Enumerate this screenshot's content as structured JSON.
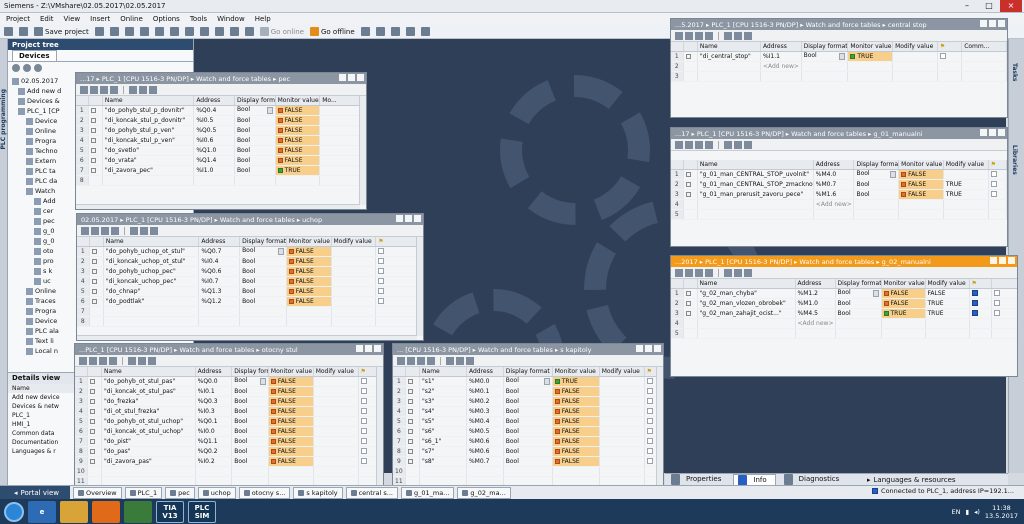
{
  "window": {
    "title": "Siemens - Z:\\VMshare\\02.05.2017\\02.05.2017"
  },
  "menu": [
    "Project",
    "Edit",
    "View",
    "Insert",
    "Online",
    "Options",
    "Tools",
    "Window",
    "Help"
  ],
  "toolbar": {
    "save_project": "Save project",
    "go_online": "Go online",
    "go_offline": "Go offline"
  },
  "left_vtab": "PLC programming",
  "project_tree": {
    "header": "Project tree",
    "tab": "Devices",
    "items": [
      "02.05.2017",
      "Add new d",
      "Devices &",
      "PLC_1 [CP",
      "Device",
      "Online",
      "Progra",
      "Techno",
      "Extern",
      "PLC ta",
      "PLC da",
      "Watch",
      "Add",
      "cer",
      "pec",
      "g_0",
      "g_0",
      "oto",
      "pro",
      "s k",
      "uc",
      "Online",
      "Traces",
      "Progra",
      "Device",
      "PLC ala",
      "Text li",
      "Local n"
    ]
  },
  "details_view": {
    "header": "Details view",
    "name_col": "Name",
    "items": [
      "Add new device",
      "Devices & netw",
      "PLC_1",
      "HMI_1",
      "Common data",
      "Documentation",
      "Languages & r"
    ]
  },
  "right_vtabs": [
    "Tasks",
    "Libraries"
  ],
  "columns": {
    "name": "Name",
    "address": "Address",
    "display_format": "Display format",
    "monitor_value": "Monitor value",
    "modify_value": "Modify value",
    "comment": "Comm...",
    "mo": "Mo..."
  },
  "add_new": "<Add new>",
  "wt_pec": {
    "title": "...17 ▸ PLC_1 [CPU 1516-3 PN/DP] ▸ Watch and force tables ▸ pec",
    "rows": [
      {
        "n": "1",
        "name": "\"do_pohyb_stul_p_dovnitr\"",
        "addr": "%Q0.4",
        "fmt": "Bool",
        "mon": "FALSE",
        "st": "off"
      },
      {
        "n": "2",
        "name": "\"di_koncak_stul_p_dovnitr\"",
        "addr": "%I0.5",
        "fmt": "Bool",
        "mon": "FALSE",
        "st": "off"
      },
      {
        "n": "3",
        "name": "\"do_pohyb_stul_p_ven\"",
        "addr": "%Q0.5",
        "fmt": "Bool",
        "mon": "FALSE",
        "st": "off"
      },
      {
        "n": "4",
        "name": "\"di_koncak_stul_p_ven\"",
        "addr": "%I0.6",
        "fmt": "Bool",
        "mon": "FALSE",
        "st": "off"
      },
      {
        "n": "5",
        "name": "\"do_svetlo\"",
        "addr": "%Q1.0",
        "fmt": "Bool",
        "mon": "FALSE",
        "st": "off"
      },
      {
        "n": "6",
        "name": "\"do_vrata\"",
        "addr": "%Q1.4",
        "fmt": "Bool",
        "mon": "FALSE",
        "st": "off"
      },
      {
        "n": "7",
        "name": "\"di_zavora_pec\"",
        "addr": "%I1.0",
        "fmt": "Bool",
        "mon": "TRUE",
        "st": "on"
      }
    ]
  },
  "wt_uchop": {
    "title": "02.05.2017 ▸ PLC_1 [CPU 1516-3 PN/DP] ▸ Watch and force tables ▸ uchop",
    "rows": [
      {
        "n": "1",
        "name": "\"do_pohyb_uchop_ot_stul\"",
        "addr": "%Q0.7",
        "fmt": "Bool",
        "mon": "FALSE",
        "st": "off"
      },
      {
        "n": "2",
        "name": "\"di_koncak_uchop_ot_stul\"",
        "addr": "%I0.4",
        "fmt": "Bool",
        "mon": "FALSE",
        "st": "off"
      },
      {
        "n": "3",
        "name": "\"do_pohyb_uchop_pec\"",
        "addr": "%Q0.6",
        "fmt": "Bool",
        "mon": "FALSE",
        "st": "off"
      },
      {
        "n": "4",
        "name": "\"di_koncak_uchop_pec\"",
        "addr": "%I0.7",
        "fmt": "Bool",
        "mon": "FALSE",
        "st": "off"
      },
      {
        "n": "5",
        "name": "\"do_chnap\"",
        "addr": "%Q1.3",
        "fmt": "Bool",
        "mon": "FALSE",
        "st": "off"
      },
      {
        "n": "6",
        "name": "\"do_podtlak\"",
        "addr": "%Q1.2",
        "fmt": "Bool",
        "mon": "FALSE",
        "st": "off"
      }
    ]
  },
  "wt_otocny": {
    "title": "...PLC_1 [CPU 1516-3 PN/DP] ▸ Watch and force tables ▸ otocny stul",
    "rows": [
      {
        "n": "1",
        "name": "\"do_pohyb_ot_stul_pas\"",
        "addr": "%Q0.0",
        "fmt": "Bool",
        "mon": "FALSE",
        "st": "off"
      },
      {
        "n": "2",
        "name": "\"di_koncak_ot_stul_pas\"",
        "addr": "%I0.1",
        "fmt": "Bool",
        "mon": "FALSE",
        "st": "off"
      },
      {
        "n": "3",
        "name": "\"do_frezka\"",
        "addr": "%Q0.3",
        "fmt": "Bool",
        "mon": "FALSE",
        "st": "off"
      },
      {
        "n": "4",
        "name": "\"di_ot_stul_frezka\"",
        "addr": "%I0.3",
        "fmt": "Bool",
        "mon": "FALSE",
        "st": "off"
      },
      {
        "n": "5",
        "name": "\"do_pohyb_ot_stul_uchop\"",
        "addr": "%Q0.1",
        "fmt": "Bool",
        "mon": "FALSE",
        "st": "off"
      },
      {
        "n": "6",
        "name": "\"di_koncak_ot_stul_uchop\"",
        "addr": "%I0.0",
        "fmt": "Bool",
        "mon": "FALSE",
        "st": "off"
      },
      {
        "n": "7",
        "name": "\"do_pist\"",
        "addr": "%Q1.1",
        "fmt": "Bool",
        "mon": "FALSE",
        "st": "off"
      },
      {
        "n": "8",
        "name": "\"do_pas\"",
        "addr": "%Q0.2",
        "fmt": "Bool",
        "mon": "FALSE",
        "st": "off"
      },
      {
        "n": "9",
        "name": "\"di_zavora_pas\"",
        "addr": "%I0.2",
        "fmt": "Bool",
        "mon": "FALSE",
        "st": "off"
      }
    ]
  },
  "wt_kapitoly": {
    "title": "... [CPU 1516-3 PN/DP] ▸ Watch and force tables ▸ s kapitoly",
    "rows": [
      {
        "n": "1",
        "name": "\"s1\"",
        "addr": "%M0.0",
        "fmt": "Bool",
        "mon": "TRUE",
        "st": "on"
      },
      {
        "n": "2",
        "name": "\"s2\"",
        "addr": "%M0.1",
        "fmt": "Bool",
        "mon": "FALSE",
        "st": "off"
      },
      {
        "n": "3",
        "name": "\"s3\"",
        "addr": "%M0.2",
        "fmt": "Bool",
        "mon": "FALSE",
        "st": "off"
      },
      {
        "n": "4",
        "name": "\"s4\"",
        "addr": "%M0.3",
        "fmt": "Bool",
        "mon": "FALSE",
        "st": "off"
      },
      {
        "n": "5",
        "name": "\"s5\"",
        "addr": "%M0.4",
        "fmt": "Bool",
        "mon": "FALSE",
        "st": "off"
      },
      {
        "n": "6",
        "name": "\"s6\"",
        "addr": "%M0.5",
        "fmt": "Bool",
        "mon": "FALSE",
        "st": "off"
      },
      {
        "n": "7",
        "name": "\"s6_1\"",
        "addr": "%M0.6",
        "fmt": "Bool",
        "mon": "FALSE",
        "st": "off"
      },
      {
        "n": "8",
        "name": "\"s7\"",
        "addr": "%M0.6",
        "fmt": "Bool",
        "mon": "FALSE",
        "st": "off"
      },
      {
        "n": "9",
        "name": "\"s8\"",
        "addr": "%M0.7",
        "fmt": "Bool",
        "mon": "FALSE",
        "st": "off"
      }
    ]
  },
  "wt_central": {
    "title": "...5.2017 ▸ PLC_1 [CPU 1516-3 PN/DP] ▸ Watch and force tables ▸ central stop",
    "rows": [
      {
        "n": "1",
        "name": "\"di_central_stop\"",
        "addr": "%I1.1",
        "fmt": "Bool",
        "mon": "TRUE",
        "st": "on",
        "mod": ""
      }
    ]
  },
  "wt_g01": {
    "title": "...17 ▸ PLC_1 [CPU 1516-3 PN/DP] ▸ Watch and force tables ▸ g_01_manualni",
    "rows": [
      {
        "n": "1",
        "name": "\"g_01_man_CENTRAL_STOP_uvolnit\"",
        "addr": "%M4.0",
        "fmt": "Bool",
        "mon": "FALSE",
        "st": "off",
        "mod": ""
      },
      {
        "n": "2",
        "name": "\"g_01_man_CENTRAL_STOP_zmacknout\"",
        "addr": "%M0.7",
        "fmt": "Bool",
        "mon": "FALSE",
        "st": "off",
        "mod": "TRUE"
      },
      {
        "n": "3",
        "name": "\"g_01_man_prerusit_zavoru_pece\"",
        "addr": "%M1.6",
        "fmt": "Bool",
        "mon": "FALSE",
        "st": "off",
        "mod": "TRUE"
      }
    ]
  },
  "wt_g02": {
    "title": "...2017 ▸ PLC_1 [CPU 1516-3 PN/DP] ▸ Watch and force tables ▸ g_02_manualni",
    "rows": [
      {
        "n": "1",
        "name": "\"g_02_man_chyba\"",
        "addr": "%M1.2",
        "fmt": "Bool",
        "mon": "FALSE",
        "st": "off",
        "mod": "FALSE",
        "chk": true
      },
      {
        "n": "2",
        "name": "\"g_02_man_vlozen_obrobek\"",
        "addr": "%M1.0",
        "fmt": "Bool",
        "mon": "FALSE",
        "st": "off",
        "mod": "TRUE",
        "chk": true
      },
      {
        "n": "3",
        "name": "\"g_02_man_zahajit_ocist...\"",
        "addr": "%M4.5",
        "fmt": "Bool",
        "mon": "TRUE",
        "st": "on",
        "mod": "TRUE",
        "chk": true
      }
    ]
  },
  "inspector": {
    "properties": "Properties",
    "info": "Info",
    "diagnostics": "Diagnostics"
  },
  "languages": "Languages & resources",
  "portal": {
    "portal_view": "Portal view",
    "tabs": [
      "Overview",
      "PLC_1",
      "pec",
      "uchop",
      "otocny s...",
      "s kapitoly",
      "central s...",
      "g_01_ma...",
      "g_02_ma..."
    ],
    "status": "Connected to PLC_1, address IP=192.1..."
  },
  "taskbar": {
    "apps": [
      "TIA V13",
      "PLC SIM"
    ],
    "lang": "EN",
    "time": "11:38",
    "date": "13.5.2017"
  },
  "colors": {
    "monitor": "#f7ce8a",
    "active_title": "#f39a1b",
    "inactive_title": "#8c96a3",
    "workspace": "#2f3f57"
  }
}
